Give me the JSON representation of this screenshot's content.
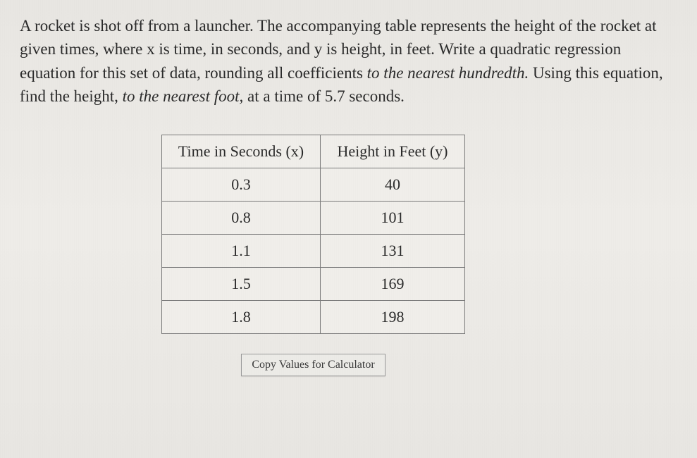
{
  "problem": {
    "part1": "A rocket is shot off from a launcher. The accompanying table represents the height of the rocket at given times, where x is time, in seconds, and y is height, in feet. Write a quadratic regression equation for this set of data, rounding all coefficients ",
    "italic1": "to the nearest hundredth.",
    "part2": " Using this equation, find the height, ",
    "italic2": "to the nearest foot,",
    "part3": " at a time of 5.7 seconds."
  },
  "table": {
    "headers": {
      "col1": "Time in Seconds (x)",
      "col2": "Height in Feet (y)"
    },
    "rows": [
      {
        "x": "0.3",
        "y": "40"
      },
      {
        "x": "0.8",
        "y": "101"
      },
      {
        "x": "1.1",
        "y": "131"
      },
      {
        "x": "1.5",
        "y": "169"
      },
      {
        "x": "1.8",
        "y": "198"
      }
    ]
  },
  "button": {
    "copy_label": "Copy Values for Calculator"
  }
}
